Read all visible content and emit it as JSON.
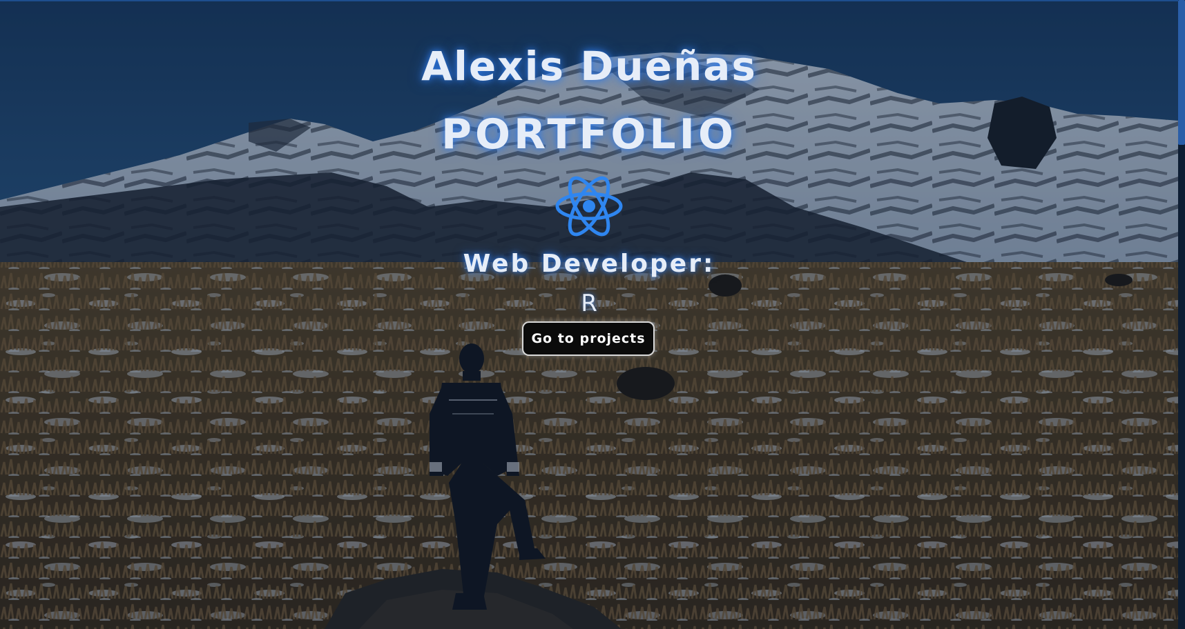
{
  "hero": {
    "owner_name": "Alexis Dueñas",
    "title": "PORTFOLIO",
    "logo_icon": "react-atom-icon",
    "role_label": "Web Developer:",
    "typed_text": "R",
    "projects_button_label": "Go to projects"
  },
  "colors": {
    "glow": "#2d78e6",
    "text": "#e6edf8",
    "button_bg": "#0b0b0b",
    "button_border": "#d9d9d9",
    "scrollbar_thumb": "#2a5ea8",
    "scrollbar_track": "#0d1d33"
  }
}
